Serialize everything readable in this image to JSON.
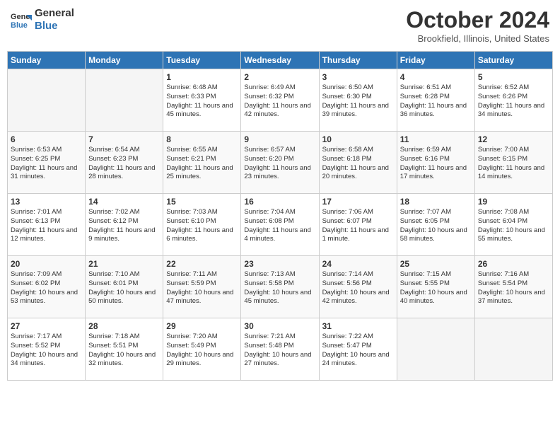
{
  "header": {
    "logo_line1": "General",
    "logo_line2": "Blue",
    "month": "October 2024",
    "location": "Brookfield, Illinois, United States"
  },
  "days_of_week": [
    "Sunday",
    "Monday",
    "Tuesday",
    "Wednesday",
    "Thursday",
    "Friday",
    "Saturday"
  ],
  "weeks": [
    [
      {
        "day": "",
        "empty": true
      },
      {
        "day": "",
        "empty": true
      },
      {
        "day": "1",
        "sunrise": "6:48 AM",
        "sunset": "6:33 PM",
        "daylight": "11 hours and 45 minutes."
      },
      {
        "day": "2",
        "sunrise": "6:49 AM",
        "sunset": "6:32 PM",
        "daylight": "11 hours and 42 minutes."
      },
      {
        "day": "3",
        "sunrise": "6:50 AM",
        "sunset": "6:30 PM",
        "daylight": "11 hours and 39 minutes."
      },
      {
        "day": "4",
        "sunrise": "6:51 AM",
        "sunset": "6:28 PM",
        "daylight": "11 hours and 36 minutes."
      },
      {
        "day": "5",
        "sunrise": "6:52 AM",
        "sunset": "6:26 PM",
        "daylight": "11 hours and 34 minutes."
      }
    ],
    [
      {
        "day": "6",
        "sunrise": "6:53 AM",
        "sunset": "6:25 PM",
        "daylight": "11 hours and 31 minutes."
      },
      {
        "day": "7",
        "sunrise": "6:54 AM",
        "sunset": "6:23 PM",
        "daylight": "11 hours and 28 minutes."
      },
      {
        "day": "8",
        "sunrise": "6:55 AM",
        "sunset": "6:21 PM",
        "daylight": "11 hours and 25 minutes."
      },
      {
        "day": "9",
        "sunrise": "6:57 AM",
        "sunset": "6:20 PM",
        "daylight": "11 hours and 23 minutes."
      },
      {
        "day": "10",
        "sunrise": "6:58 AM",
        "sunset": "6:18 PM",
        "daylight": "11 hours and 20 minutes."
      },
      {
        "day": "11",
        "sunrise": "6:59 AM",
        "sunset": "6:16 PM",
        "daylight": "11 hours and 17 minutes."
      },
      {
        "day": "12",
        "sunrise": "7:00 AM",
        "sunset": "6:15 PM",
        "daylight": "11 hours and 14 minutes."
      }
    ],
    [
      {
        "day": "13",
        "sunrise": "7:01 AM",
        "sunset": "6:13 PM",
        "daylight": "11 hours and 12 minutes."
      },
      {
        "day": "14",
        "sunrise": "7:02 AM",
        "sunset": "6:12 PM",
        "daylight": "11 hours and 9 minutes."
      },
      {
        "day": "15",
        "sunrise": "7:03 AM",
        "sunset": "6:10 PM",
        "daylight": "11 hours and 6 minutes."
      },
      {
        "day": "16",
        "sunrise": "7:04 AM",
        "sunset": "6:08 PM",
        "daylight": "11 hours and 4 minutes."
      },
      {
        "day": "17",
        "sunrise": "7:06 AM",
        "sunset": "6:07 PM",
        "daylight": "11 hours and 1 minute."
      },
      {
        "day": "18",
        "sunrise": "7:07 AM",
        "sunset": "6:05 PM",
        "daylight": "10 hours and 58 minutes."
      },
      {
        "day": "19",
        "sunrise": "7:08 AM",
        "sunset": "6:04 PM",
        "daylight": "10 hours and 55 minutes."
      }
    ],
    [
      {
        "day": "20",
        "sunrise": "7:09 AM",
        "sunset": "6:02 PM",
        "daylight": "10 hours and 53 minutes."
      },
      {
        "day": "21",
        "sunrise": "7:10 AM",
        "sunset": "6:01 PM",
        "daylight": "10 hours and 50 minutes."
      },
      {
        "day": "22",
        "sunrise": "7:11 AM",
        "sunset": "5:59 PM",
        "daylight": "10 hours and 47 minutes."
      },
      {
        "day": "23",
        "sunrise": "7:13 AM",
        "sunset": "5:58 PM",
        "daylight": "10 hours and 45 minutes."
      },
      {
        "day": "24",
        "sunrise": "7:14 AM",
        "sunset": "5:56 PM",
        "daylight": "10 hours and 42 minutes."
      },
      {
        "day": "25",
        "sunrise": "7:15 AM",
        "sunset": "5:55 PM",
        "daylight": "10 hours and 40 minutes."
      },
      {
        "day": "26",
        "sunrise": "7:16 AM",
        "sunset": "5:54 PM",
        "daylight": "10 hours and 37 minutes."
      }
    ],
    [
      {
        "day": "27",
        "sunrise": "7:17 AM",
        "sunset": "5:52 PM",
        "daylight": "10 hours and 34 minutes."
      },
      {
        "day": "28",
        "sunrise": "7:18 AM",
        "sunset": "5:51 PM",
        "daylight": "10 hours and 32 minutes."
      },
      {
        "day": "29",
        "sunrise": "7:20 AM",
        "sunset": "5:49 PM",
        "daylight": "10 hours and 29 minutes."
      },
      {
        "day": "30",
        "sunrise": "7:21 AM",
        "sunset": "5:48 PM",
        "daylight": "10 hours and 27 minutes."
      },
      {
        "day": "31",
        "sunrise": "7:22 AM",
        "sunset": "5:47 PM",
        "daylight": "10 hours and 24 minutes."
      },
      {
        "day": "",
        "empty": true
      },
      {
        "day": "",
        "empty": true
      }
    ]
  ]
}
